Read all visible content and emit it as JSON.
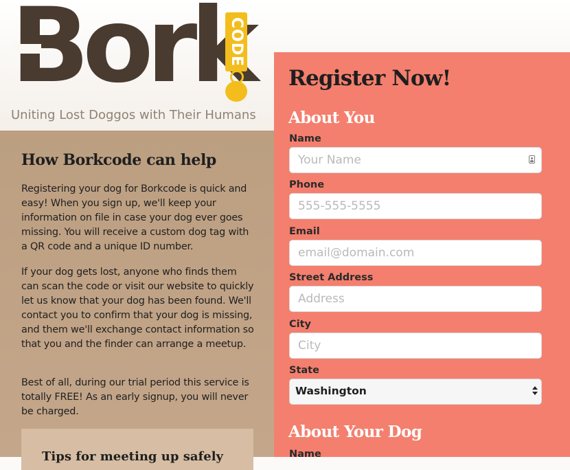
{
  "brand": {
    "logo_word": "Bork",
    "logo_tag": "CODE",
    "tagline": "Uniting Lost Doggos with Their Humans",
    "colors": {
      "logo_dark": "#4a3b30",
      "tag_yellow": "#f2bd1d"
    }
  },
  "info": {
    "heading": "How Borkcode can help",
    "paragraphs": [
      "Registering your dog for Borkcode is quick and easy! When you sign up, we'll keep your information on file in case your dog ever goes missing. You will receive a custom dog tag with a QR code and a unique ID number.",
      "If your dog gets lost, anyone who finds them can scan the code or visit our website to quickly let us know that your dog has been found. We'll contact you to confirm that your dog is missing, and them we'll exchange contact information so that you and the finder can arrange a meetup.",
      "Best of all, during our trial period this service is totally FREE! As an early signup, you will never be charged."
    ],
    "tips_heading": "Tips for meeting up safely",
    "background_color": "#bc9f81"
  },
  "form": {
    "title": "Register Now!",
    "background_color": "#f47f6e",
    "about_you": {
      "heading": "About You",
      "fields": [
        {
          "label": "Name",
          "placeholder": "Your Name",
          "icon": "contact-card-icon"
        },
        {
          "label": "Phone",
          "placeholder": "555-555-5555"
        },
        {
          "label": "Email",
          "placeholder": "email@domain.com"
        },
        {
          "label": "Street Address",
          "placeholder": "Address"
        },
        {
          "label": "City",
          "placeholder": "City"
        }
      ],
      "state": {
        "label": "State",
        "value": "Washington"
      }
    },
    "about_dog": {
      "heading": "About Your Dog",
      "first_label": "Name"
    }
  }
}
